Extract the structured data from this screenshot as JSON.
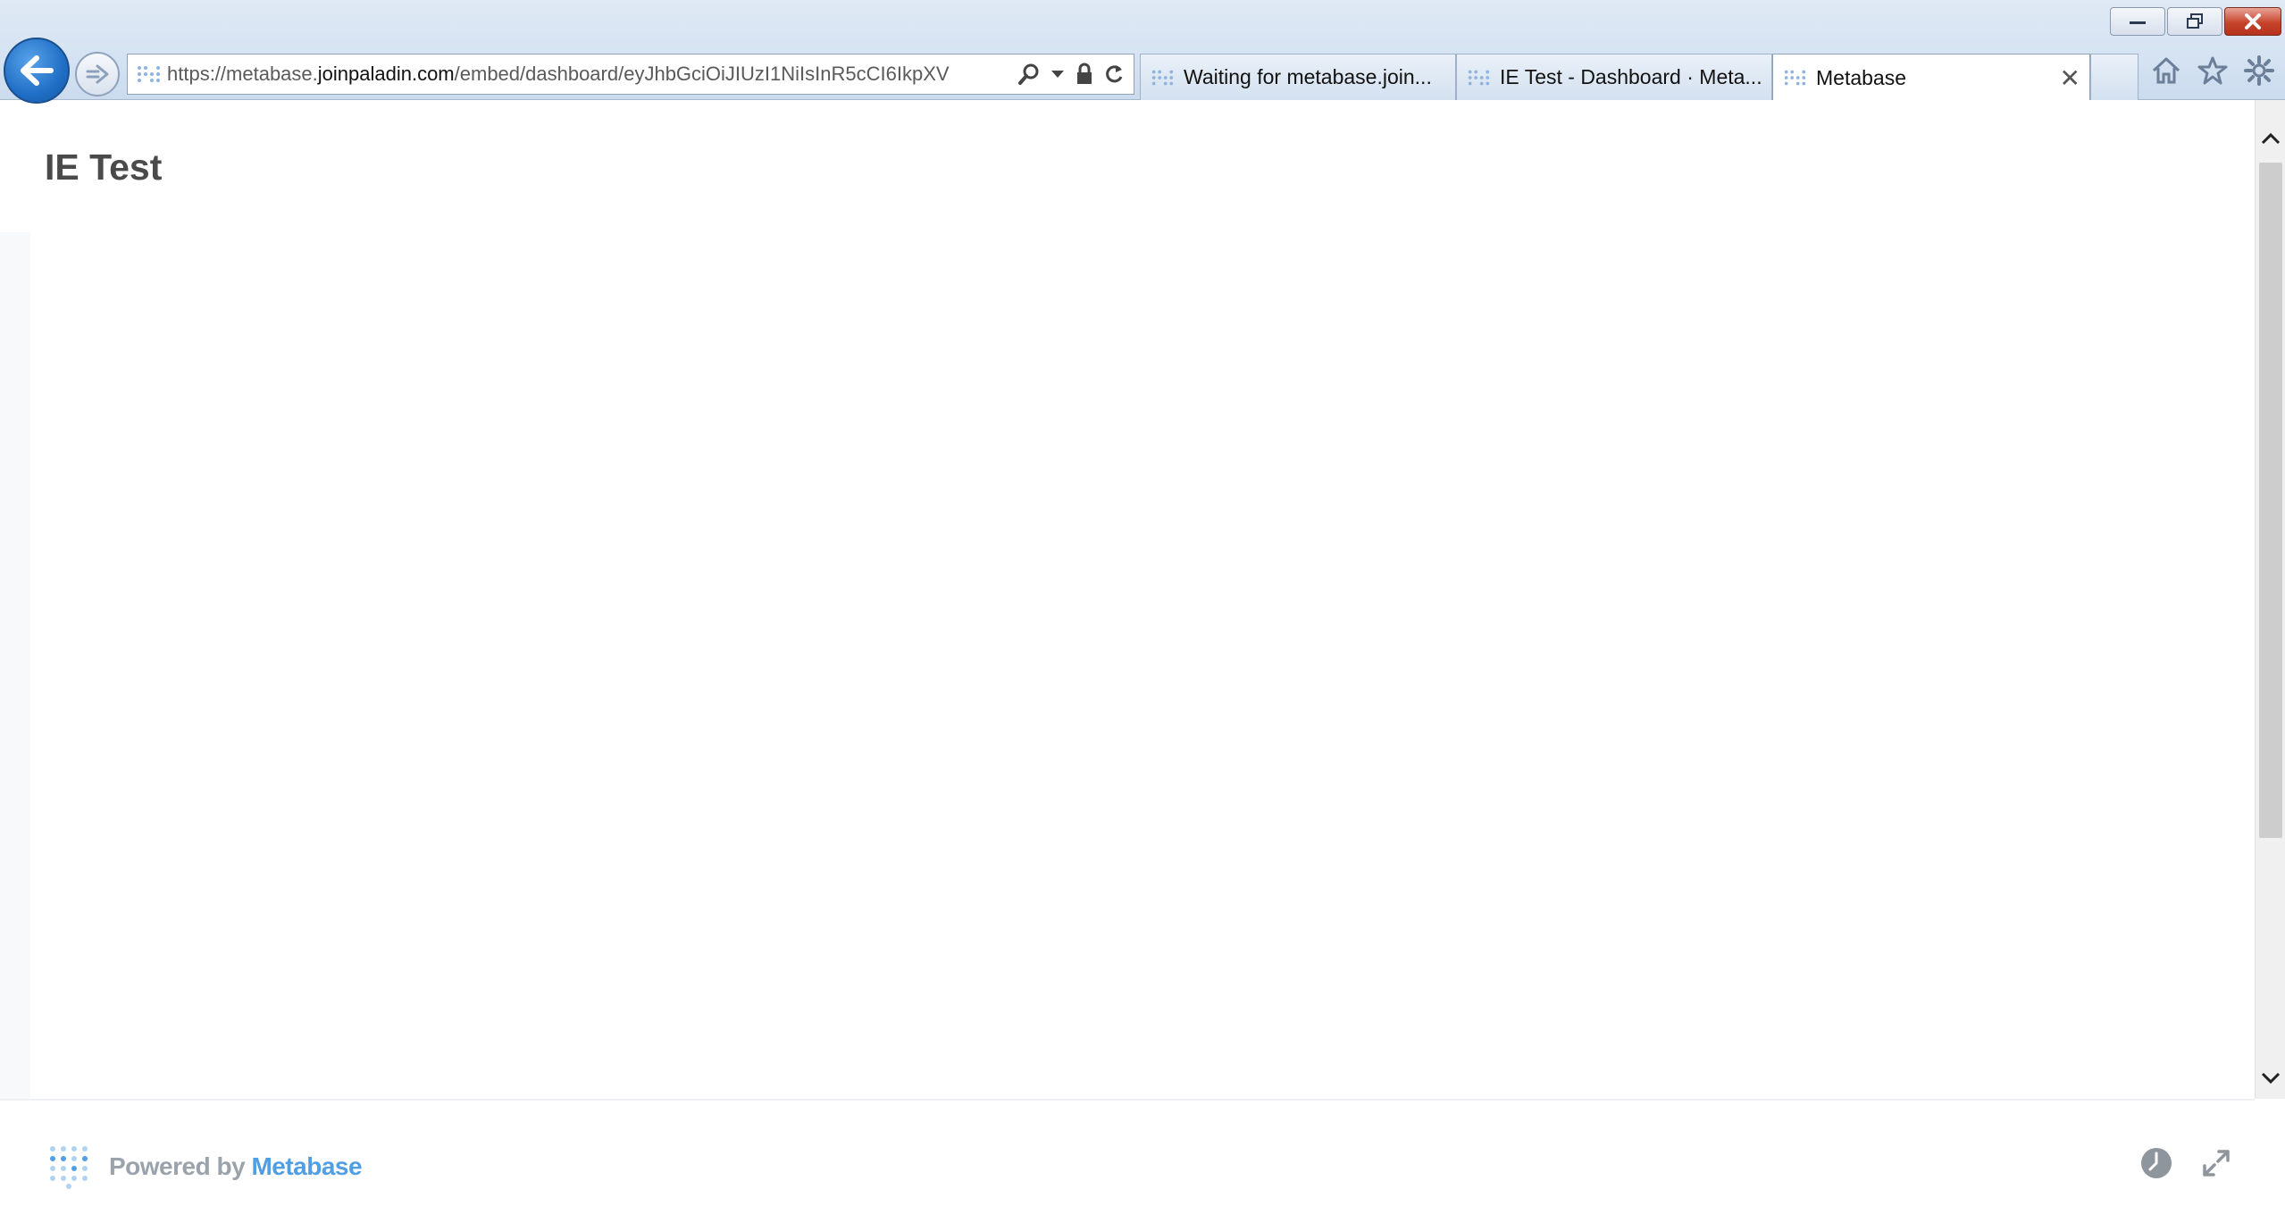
{
  "browser": {
    "address": {
      "url_prefix": "https://metabase.",
      "url_domain": "joinpaladin.com",
      "url_path": "/embed/dashboard/eyJhbGciOiJIUzI1NiIsInR5cCI6IkpXV"
    },
    "tabs": [
      {
        "label": "Waiting for metabase.join..."
      },
      {
        "label": "IE Test - Dashboard · Meta..."
      },
      {
        "label": "Metabase"
      }
    ],
    "tab_close": "✕"
  },
  "dashboard": {
    "title": "IE Test"
  },
  "footer": {
    "powered_by": "Powered by",
    "brand": "Metabase"
  },
  "colors": {
    "brand_blue": "#509ee3",
    "title_gray": "#4a4a4a",
    "ie_back_blue": "#1f6fc6"
  }
}
